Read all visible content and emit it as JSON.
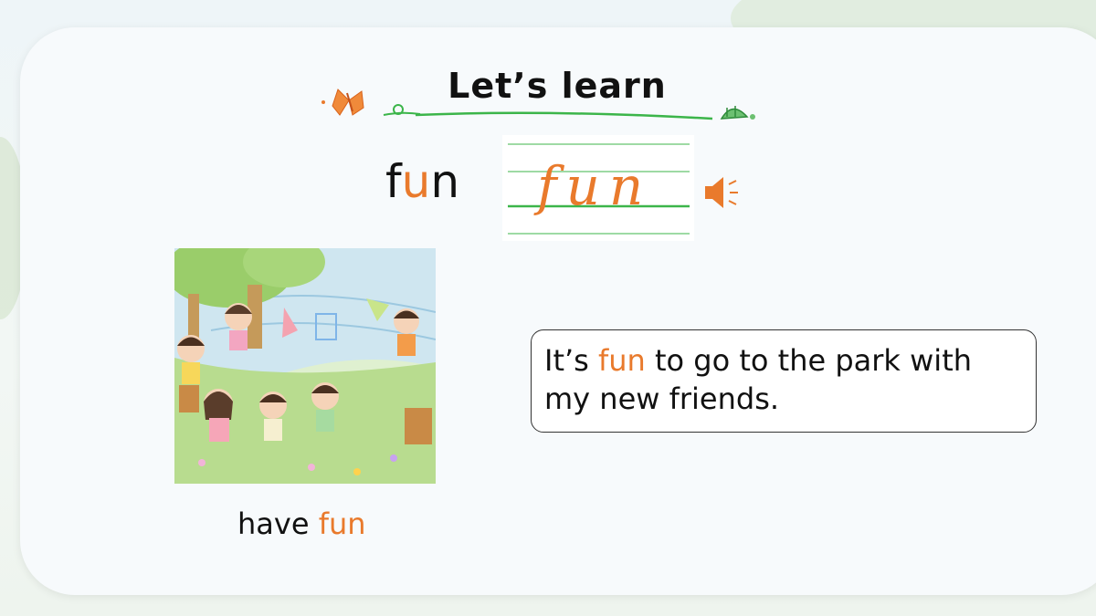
{
  "header": {
    "title": "Let’s learn"
  },
  "word": {
    "prefix": "f",
    "highlight": "u",
    "suffix": "n"
  },
  "handwriting": {
    "text": "fun"
  },
  "picture": {
    "caption_prefix": "have ",
    "caption_highlight": "fun"
  },
  "sentence": {
    "before": "It’s ",
    "highlight": "fun",
    "after": " to go to the park with my new friends."
  },
  "colors": {
    "accent": "#e97a2c",
    "green": "#3cb54a"
  },
  "icons": {
    "speaker": "speaker-icon",
    "butterfly": "butterfly-icon",
    "snail": "snail-icon"
  }
}
